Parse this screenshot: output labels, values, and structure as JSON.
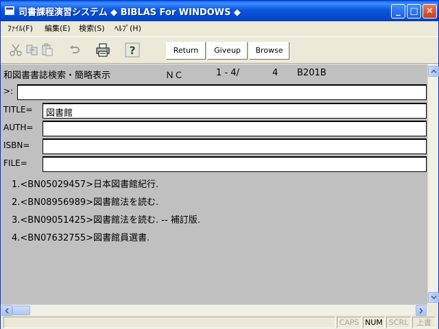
{
  "window": {
    "title": "司書課程演習システム ◆ BIBLAS For WINDOWS ◆",
    "controls": {
      "minimize": "_",
      "maximize": "□",
      "close": "✕"
    }
  },
  "menu": {
    "items": [
      {
        "label": "ﾌｧｲﾙ(F)"
      },
      {
        "label": "編集(E)"
      },
      {
        "label": "検索(S)"
      },
      {
        "label": "ﾍﾙﾌﾟ(H)"
      }
    ]
  },
  "toolbar": {
    "icons": [
      "scissors-icon",
      "copy-icon",
      "paste-icon",
      "undo-icon",
      "printer-icon",
      "help-icon"
    ],
    "buttons": {
      "return": "Return",
      "giveup": "Giveup",
      "browse": "Browse"
    }
  },
  "screen": {
    "header": {
      "title": "和図書書誌検索・簡略表示",
      "code": "ＮＣ",
      "range": "1 -   4/",
      "total": "4",
      "screen_id": "B201B"
    },
    "prompt": {
      "label": ">:",
      "value": ""
    },
    "fields": {
      "title": {
        "label": "TITLE=",
        "value": "図書館"
      },
      "auth": {
        "label": "AUTH=",
        "value": ""
      },
      "isbn": {
        "label": "ISBN=",
        "value": ""
      },
      "file": {
        "label": "FILE=",
        "value": ""
      }
    },
    "results": [
      "1.<BN05029457>日本図書館紀行.",
      "2.<BN08956989>図書館法を読む.",
      "3.<BN09051425>図書館法を読む. -- 補訂版.",
      "4.<BN07632755>図書館員選書."
    ]
  },
  "statusbar": {
    "caps": "CAPS",
    "num": "NUM",
    "scrl": "SCRL",
    "mode": "上書"
  },
  "colors": {
    "titlebar": "#0a57dc",
    "content_bg": "#c0c0c0",
    "window_bg": "#ece9d8"
  }
}
